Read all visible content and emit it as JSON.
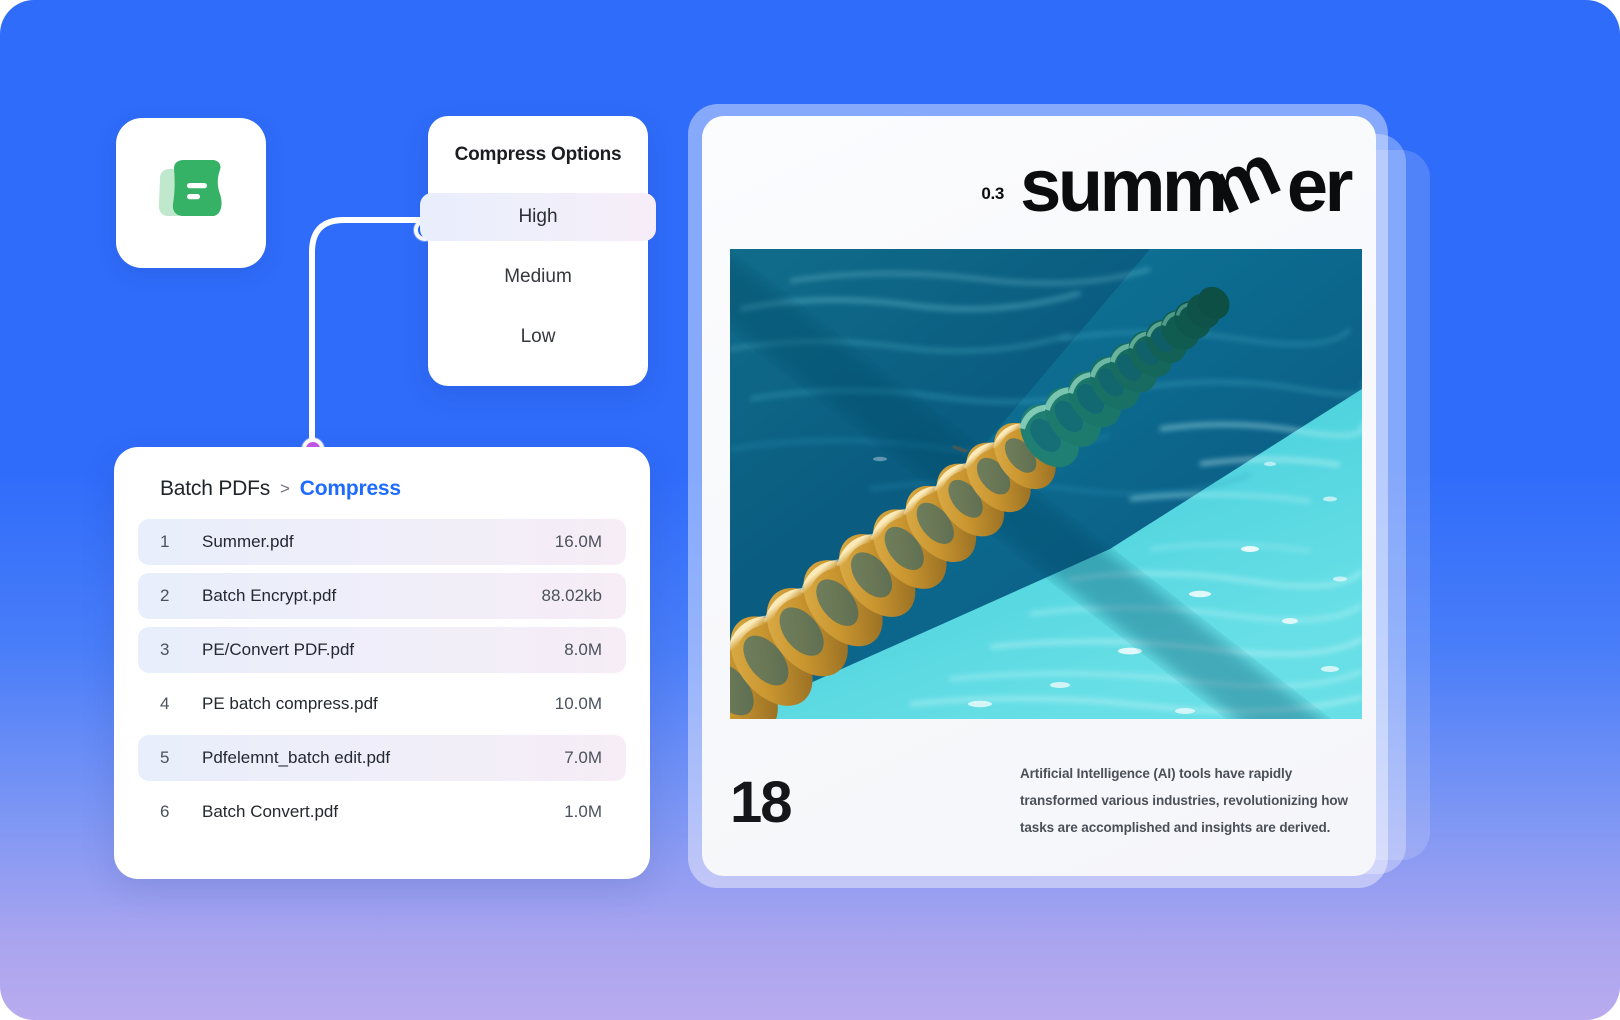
{
  "background": {
    "top_color": "#2f6cfa",
    "bottom_color": "#b9abef"
  },
  "logo": {
    "name": "pdfelement-logo-icon",
    "primary_color": "#36b267",
    "secondary_color": "#bfe8cd"
  },
  "connector": {
    "line_color": "#ffffff",
    "top_dot_color": "#1f6bff",
    "bottom_dot_color": "#c755ea"
  },
  "compress_options": {
    "title": "Compress Options",
    "selected": "High",
    "options": [
      {
        "label": "High",
        "selected": true
      },
      {
        "label": "Medium",
        "selected": false
      },
      {
        "label": "Low",
        "selected": false
      }
    ]
  },
  "batch_card": {
    "breadcrumb": {
      "root": "Batch PDFs",
      "separator": ">",
      "current": "Compress",
      "current_color": "#1f6bff"
    },
    "files": [
      {
        "index": "1",
        "name": "Summer.pdf",
        "size": "16.0M",
        "shaded": true
      },
      {
        "index": "2",
        "name": "Batch Encrypt.pdf",
        "size": "88.02kb",
        "shaded": true
      },
      {
        "index": "3",
        "name": "PE/Convert PDF.pdf",
        "size": "8.0M",
        "shaded": true
      },
      {
        "index": "4",
        "name": "PE batch compress.pdf",
        "size": "10.0M",
        "shaded": false
      },
      {
        "index": "5",
        "name": "Pdfelemnt_batch edit.pdf",
        "size": "7.0M",
        "shaded": true
      },
      {
        "index": "6",
        "name": "Batch Convert.pdf",
        "size": "1.0M",
        "shaded": false
      }
    ]
  },
  "preview": {
    "issue_number": "0.3",
    "masthead_part_1": "summ",
    "masthead_tilt_letter": "m",
    "masthead_part_2": "er",
    "photo_alt": "swimming-pool-lane-rope-photo",
    "page_number": "18",
    "paragraph": "Artificial Intelligence (AI) tools have rapidly transformed various industries, revolutionizing how tasks are accomplished and insights are derived."
  }
}
